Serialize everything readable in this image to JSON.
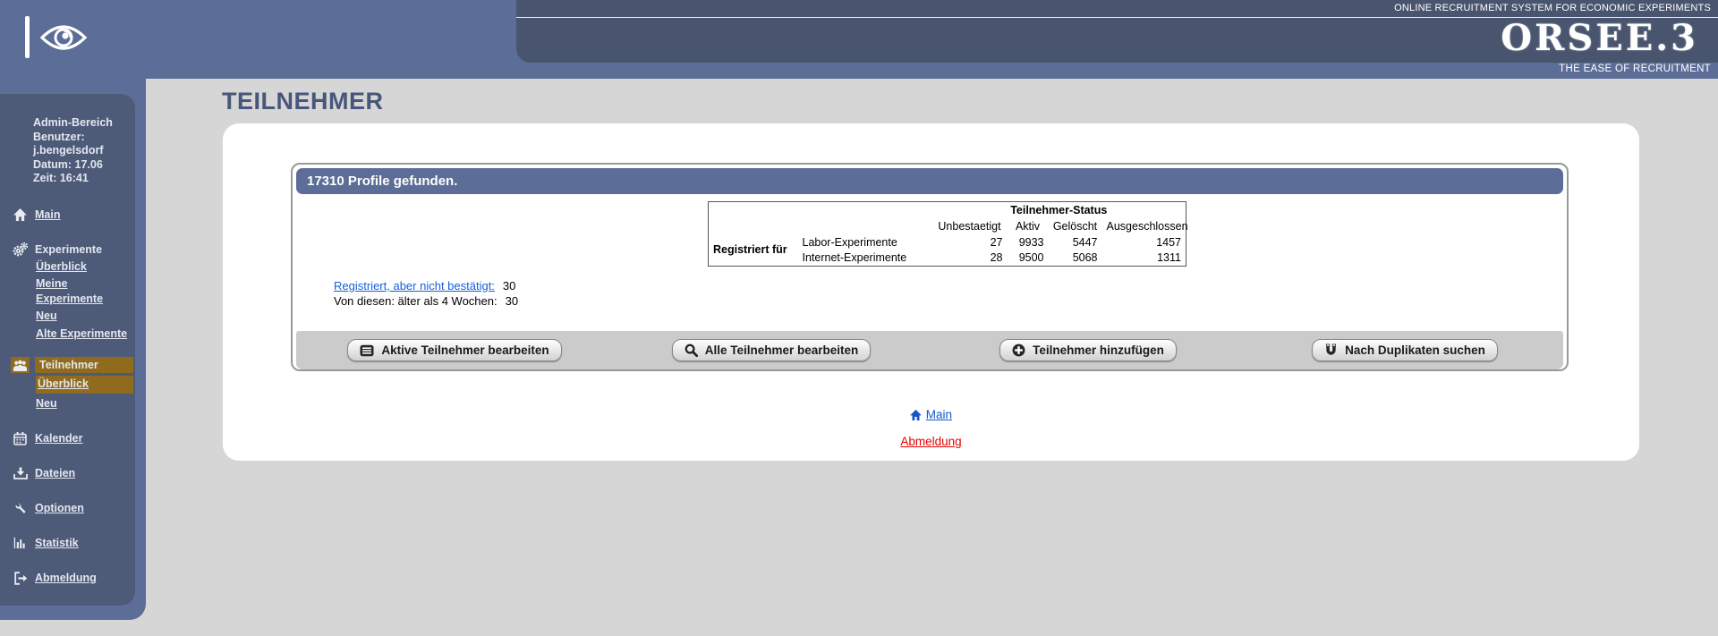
{
  "header": {
    "tagline_top": "ONLINE RECRUITMENT SYSTEM FOR ECONOMIC EXPERIMENTS",
    "logo_text": "ORSEE.3",
    "tagline_bottom": "THE EASE OF RECRUITMENT"
  },
  "colors": {
    "header_blue": "#5c6d97",
    "panel_dark": "#49556e",
    "sidebar_dark": "#4d5a78",
    "active_highlight_gold": "#916b1d",
    "link_blue": "#1660d9",
    "logout_red": "#e60000",
    "page_gray": "#d6d6d6"
  },
  "sidebar": {
    "admin_area": "Admin-Bereich",
    "user_label": "Benutzer:",
    "user_name": "j.bengelsdorf",
    "date_line": "Datum: 17.06",
    "time_line": "Zeit: 16:41",
    "nav": [
      {
        "label": "Main",
        "icon": "home-icon"
      },
      {
        "label": "Experimente",
        "icon": "gears-icon",
        "subs": [
          "Überblick",
          "Meine Experimente",
          "Neu",
          "Alte Experimente"
        ]
      },
      {
        "label": "Teilnehmer",
        "icon": "users-icon",
        "active": true,
        "subs": [
          "Überblick",
          "Neu"
        ]
      },
      {
        "label": "Kalender",
        "icon": "calendar-icon"
      },
      {
        "label": "Dateien",
        "icon": "download-icon"
      },
      {
        "label": "Optionen",
        "icon": "wrench-icon"
      },
      {
        "label": "Statistik",
        "icon": "bar-chart-icon"
      },
      {
        "label": "Abmeldung",
        "icon": "logout-icon"
      }
    ]
  },
  "main": {
    "page_title": "TEILNEHMER",
    "results_header": "17310 Profile gefunden.",
    "status_table": {
      "title": "Teilnehmer-Status",
      "row_group_label": "Registriert für",
      "columns": [
        "Unbestaetigt",
        "Aktiv",
        "Gelöscht",
        "Ausgeschlossen"
      ],
      "rows": [
        {
          "label": "Labor-Experimente",
          "values": [
            27,
            9933,
            5447,
            1457
          ]
        },
        {
          "label": "Internet-Experimente",
          "values": [
            28,
            9500,
            5068,
            1311
          ]
        }
      ]
    },
    "registered_link": {
      "label": "Registriert, aber nicht bestätigt:",
      "value": "30"
    },
    "older_line": {
      "label": "Von diesen: älter als 4 Wochen:",
      "value": "30"
    },
    "buttons": [
      {
        "label": "Aktive Teilnehmer bearbeiten",
        "icon": "list-icon"
      },
      {
        "label": "Alle Teilnehmer bearbeiten",
        "icon": "search-icon"
      },
      {
        "label": "Teilnehmer hinzufügen",
        "icon": "plus-circle-icon"
      },
      {
        "label": "Nach Duplikaten suchen",
        "icon": "magnet-icon"
      }
    ],
    "footer_links": {
      "main": "Main",
      "logout": "Abmeldung"
    }
  }
}
